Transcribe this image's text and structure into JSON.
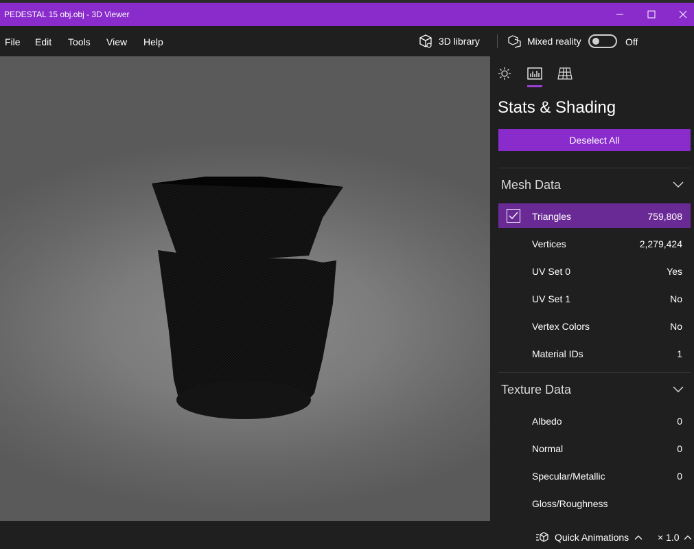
{
  "window": {
    "title": "PEDESTAL 15 obj.obj - 3D Viewer",
    "accent_color": "#8a2ccc"
  },
  "menu": {
    "items": [
      {
        "label": "File"
      },
      {
        "label": "Edit"
      },
      {
        "label": "Tools"
      },
      {
        "label": "View"
      },
      {
        "label": "Help"
      }
    ],
    "library_label": "3D library",
    "mixed_reality_label": "Mixed reality",
    "mixed_reality_state": "Off"
  },
  "panel": {
    "tabs": [
      {
        "icon": "lighting-icon"
      },
      {
        "icon": "stats-icon",
        "active": true
      },
      {
        "icon": "grid-icon"
      }
    ],
    "title": "Stats & Shading",
    "deselect_label": "Deselect All",
    "mesh": {
      "heading": "Mesh Data",
      "rows": [
        {
          "label": "Triangles",
          "value": "759,808",
          "checked": true
        },
        {
          "label": "Vertices",
          "value": "2,279,424"
        },
        {
          "label": "UV Set 0",
          "value": "Yes"
        },
        {
          "label": "UV Set 1",
          "value": "No"
        },
        {
          "label": "Vertex Colors",
          "value": "No"
        },
        {
          "label": "Material IDs",
          "value": "1"
        }
      ]
    },
    "texture": {
      "heading": "Texture Data",
      "rows": [
        {
          "label": "Albedo",
          "value": "0"
        },
        {
          "label": "Normal",
          "value": "0"
        },
        {
          "label": "Specular/Metallic",
          "value": "0"
        },
        {
          "label": "Gloss/Roughness",
          "value": ""
        }
      ]
    }
  },
  "bottom": {
    "quick_animations_label": "Quick Animations",
    "speed_label": "× 1.0"
  }
}
